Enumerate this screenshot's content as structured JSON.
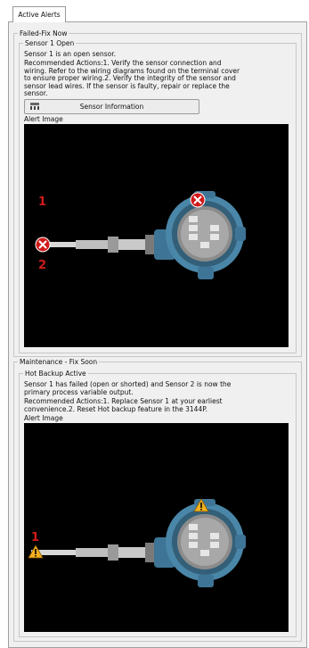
{
  "tabs": [
    {
      "label": "Active Alerts"
    }
  ],
  "failed": {
    "group_label": "Failed-Fix Now",
    "alert_title": "Sensor 1 Open",
    "description": "Sensor 1 is an open sensor.",
    "actions": [
      "Recommended Actions:1. Verify the sensor connection and",
      "wiring.  Refer to the wiring diagrams found on the terminal cover",
      "to ensure proper wiring.2. Verify the integrity of the sensor and",
      "sensor lead wires.  If the sensor is faulty, repair or replace the",
      "sensor."
    ],
    "button_label": "Sensor Information",
    "image_label": "Alert Image",
    "markers": [
      "1",
      "2"
    ]
  },
  "maintenance": {
    "group_label": "Maintenance - Fix Soon",
    "alert_title": "Hot Backup Active",
    "description": [
      "Sensor 1 has failed (open or shorted) and Sensor 2 is now the",
      "primary process variable output."
    ],
    "actions": [
      "Recommended Actions:1. Replace Sensor 1 at your earliest",
      "convenience.2. Reset Hot backup feature in the 3144P."
    ],
    "image_label": "Alert Image",
    "markers": [
      "1"
    ]
  },
  "colors": {
    "alert_red": "#d11a1a",
    "warn_yellow": "#f2b01e",
    "housing_blue": "#4a86a8"
  }
}
